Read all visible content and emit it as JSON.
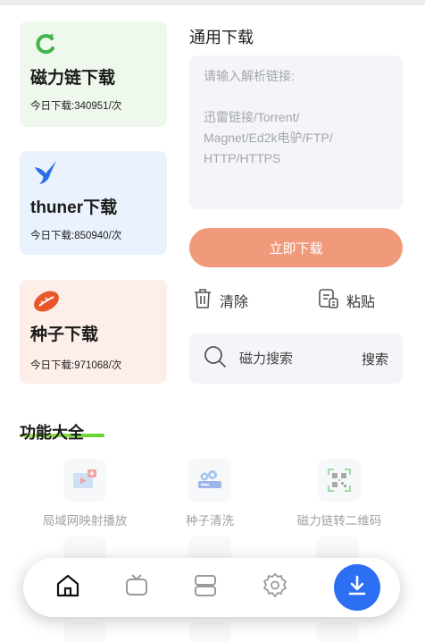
{
  "cards": [
    {
      "title": "磁力链下载",
      "count": "今日下载:340951/次",
      "icon": "magnet-icon",
      "color": "#3fb64a"
    },
    {
      "title": "thuner下载",
      "count": "今日下载:850940/次",
      "icon": "bird-icon",
      "color": "#2e6ee8"
    },
    {
      "title": "种子下载",
      "count": "今日下载:971068/次",
      "icon": "seed-icon",
      "color": "#e9582b"
    }
  ],
  "download": {
    "title": "通用下载",
    "placeholder": "请输入解析链接:\n\n迅雷链接/Torrent/\nMagnet/Ed2k电驴/FTP/\nHTTP/HTTPS",
    "button": "立即下载",
    "button_color": "#f09a7b",
    "clear": "清除",
    "paste": "粘贴"
  },
  "search": {
    "placeholder": "磁力搜索",
    "button": "搜索"
  },
  "features": {
    "title": "功能大全",
    "items": [
      {
        "label": "局域网映射播放",
        "icon": "cast-play-icon"
      },
      {
        "label": "种子清洗",
        "icon": "seed-clean-icon"
      },
      {
        "label": "磁力链转二维码",
        "icon": "qr-code-icon"
      }
    ]
  },
  "tabbar": {
    "tabs": [
      "home-icon",
      "tv-icon",
      "storage-icon",
      "settings-icon"
    ],
    "fab_icon": "download-icon",
    "fab_color": "#2d6ff2"
  }
}
